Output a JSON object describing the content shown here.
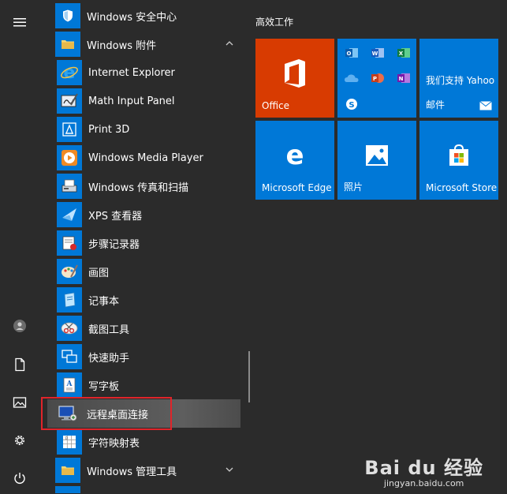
{
  "app_list": {
    "items": [
      {
        "label": "Windows 安全中心",
        "kind": "app"
      },
      {
        "label": "Windows 附件",
        "kind": "folder-open"
      },
      {
        "label": "Internet Explorer",
        "kind": "sub"
      },
      {
        "label": "Math Input Panel",
        "kind": "sub"
      },
      {
        "label": "Print 3D",
        "kind": "sub"
      },
      {
        "label": "Windows Media Player",
        "kind": "sub"
      },
      {
        "label": "Windows 传真和扫描",
        "kind": "sub"
      },
      {
        "label": "XPS 查看器",
        "kind": "sub"
      },
      {
        "label": "步骤记录器",
        "kind": "sub"
      },
      {
        "label": "画图",
        "kind": "sub"
      },
      {
        "label": "记事本",
        "kind": "sub"
      },
      {
        "label": "截图工具",
        "kind": "sub"
      },
      {
        "label": "快速助手",
        "kind": "sub"
      },
      {
        "label": "写字板",
        "kind": "sub"
      },
      {
        "label": "远程桌面连接",
        "kind": "sub-selected"
      },
      {
        "label": "字符映射表",
        "kind": "sub"
      },
      {
        "label": "Windows 管理工具",
        "kind": "folder-closed"
      }
    ]
  },
  "tiles": {
    "group_title": "高效工作",
    "office": "Office",
    "mail_text": "我们支持 Yahoo",
    "mail": "邮件",
    "edge": "Microsoft Edge",
    "photos": "照片",
    "store": "Microsoft Store"
  },
  "colors": {
    "office": "#d83b01",
    "blue": "#0078d7",
    "highlight_border": "#e0242a"
  },
  "watermark": {
    "brand": "Bai du 经验",
    "url": "jingyan.baidu.com"
  }
}
